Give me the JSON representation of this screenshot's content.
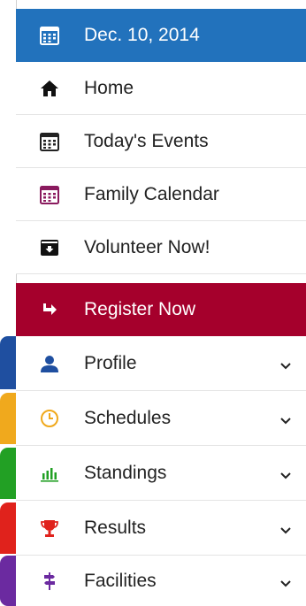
{
  "menu": {
    "date": {
      "label": "Dec. 10, 2014",
      "icon": "calendar-icon"
    },
    "items": [
      {
        "label": "Home",
        "icon": "home-icon",
        "color": "#111111"
      },
      {
        "label": "Today's Events",
        "icon": "calendar-icon",
        "color": "#222222"
      },
      {
        "label": "Family Calendar",
        "icon": "calendar-icon",
        "color": "#8a1a5e"
      },
      {
        "label": "Volunteer Now!",
        "icon": "inbox-download-icon",
        "color": "#111111"
      },
      {
        "label": "Register Now",
        "icon": "share-arrow-icon",
        "color": "#ffffff"
      }
    ],
    "sections": [
      {
        "label": "Profile",
        "icon": "user-icon",
        "color": "#1f4fa0",
        "tab_color": "#1f4fa0"
      },
      {
        "label": "Schedules",
        "icon": "clock-icon",
        "color": "#f0a91d",
        "tab_color": "#f0a91d"
      },
      {
        "label": "Standings",
        "icon": "bar-chart-icon",
        "color": "#22a024",
        "tab_color": "#22a024"
      },
      {
        "label": "Results",
        "icon": "trophy-icon",
        "color": "#e0221c",
        "tab_color": "#e0221c"
      },
      {
        "label": "Facilities",
        "icon": "signpost-icon",
        "color": "#6b2aa0",
        "tab_color": "#6b2aa0"
      }
    ],
    "accent": "#2272bc",
    "register_color": "#a5002c"
  }
}
